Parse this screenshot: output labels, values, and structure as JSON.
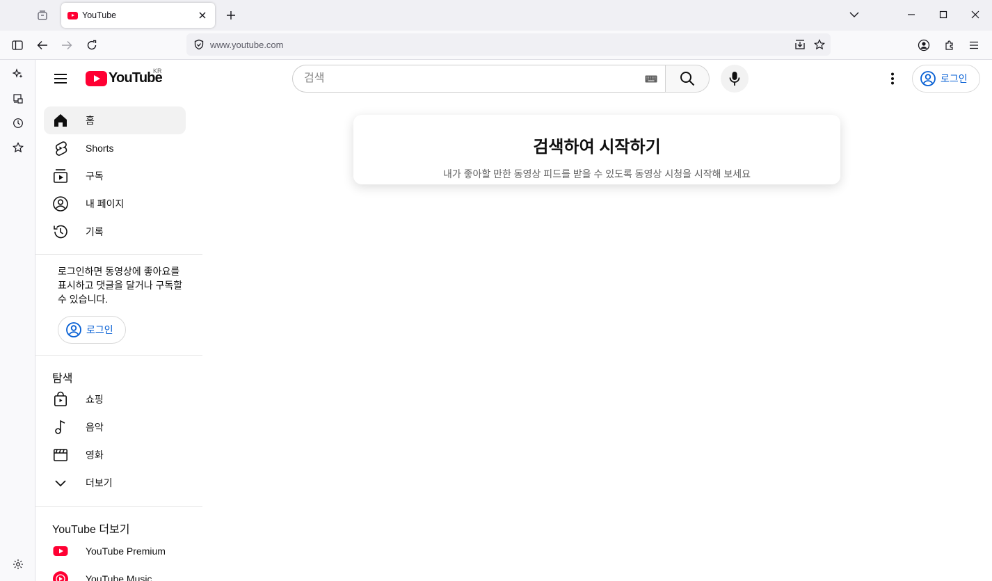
{
  "browser": {
    "tab_title": "YouTube",
    "url": "www.youtube.com"
  },
  "header": {
    "logo_text": "YouTube",
    "country_code": "KR",
    "search_placeholder": "검색",
    "signin_label": "로그인"
  },
  "guide": {
    "main_items": [
      {
        "label": "홈",
        "icon": "home-icon"
      },
      {
        "label": "Shorts",
        "icon": "shorts-icon"
      },
      {
        "label": "구독",
        "icon": "subscriptions-icon"
      },
      {
        "label": "내 페이지",
        "icon": "account-icon"
      },
      {
        "label": "기록",
        "icon": "history-icon"
      }
    ],
    "signin_prompt": "로그인하면 동영상에 좋아요를 표시하고 댓글을 달거나 구독할 수 있습니다.",
    "signin_label": "로그인",
    "explore_title": "탐색",
    "explore_items": [
      {
        "label": "쇼핑",
        "icon": "shopping-bag-icon"
      },
      {
        "label": "음악",
        "icon": "music-note-icon"
      },
      {
        "label": "영화",
        "icon": "movie-clapper-icon"
      },
      {
        "label": "더보기",
        "icon": "chevron-down-icon"
      }
    ],
    "more_title": "YouTube 더보기",
    "more_items": [
      {
        "label": "YouTube Premium",
        "icon": "youtube-premium-icon"
      },
      {
        "label": "YouTube Music",
        "icon": "youtube-music-icon"
      }
    ]
  },
  "feed_prompt": {
    "title": "검색하여 시작하기",
    "subtitle": "내가 좋아할 만한 동영상 피드를 받을 수 있도록 동영상 시청을 시작해 보세요"
  },
  "colors": {
    "brand_red": "#ff0033",
    "link_blue": "#065fd4"
  }
}
